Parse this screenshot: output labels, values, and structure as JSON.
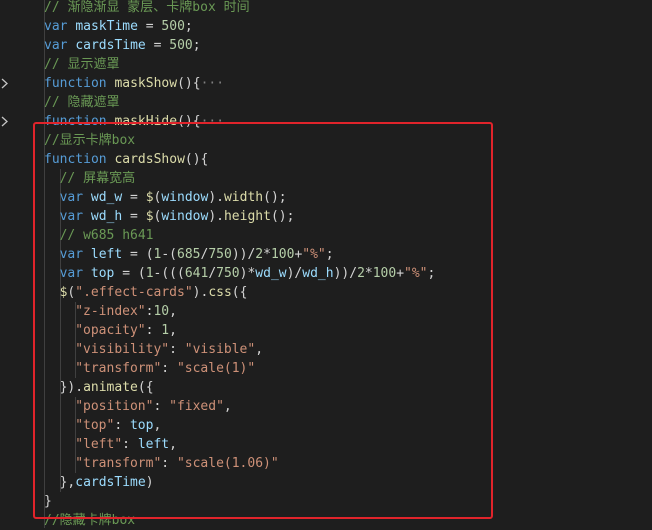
{
  "editor": {
    "lines": [
      {
        "tokens": [
          {
            "t": "// 渐隐渐显 蒙层、卡牌box 时间",
            "c": "c"
          }
        ]
      },
      {
        "tokens": [
          {
            "t": "var ",
            "c": "k"
          },
          {
            "t": "maskTime",
            "c": "v"
          },
          {
            "t": " = ",
            "c": "p"
          },
          {
            "t": "500",
            "c": "n"
          },
          {
            "t": ";",
            "c": "p"
          }
        ]
      },
      {
        "tokens": [
          {
            "t": "var ",
            "c": "k"
          },
          {
            "t": "cardsTime",
            "c": "v"
          },
          {
            "t": " = ",
            "c": "p"
          },
          {
            "t": "500",
            "c": "n"
          },
          {
            "t": ";",
            "c": "p"
          }
        ]
      },
      {
        "tokens": [
          {
            "t": "// 显示遮罩",
            "c": "c"
          }
        ]
      },
      {
        "fold": true,
        "tokens": [
          {
            "t": "function ",
            "c": "k"
          },
          {
            "t": "maskShow",
            "c": "f"
          },
          {
            "t": "(){",
            "c": "p"
          },
          {
            "t": "···",
            "c": "fold-dots"
          }
        ]
      },
      {
        "tokens": [
          {
            "t": "// 隐藏遮罩",
            "c": "c"
          }
        ]
      },
      {
        "fold": true,
        "tokens": [
          {
            "t": "function ",
            "c": "k"
          },
          {
            "t": "maskHide",
            "c": "f"
          },
          {
            "t": "(){",
            "c": "p"
          },
          {
            "t": "···",
            "c": "fold-dots"
          }
        ]
      },
      {
        "tokens": [
          {
            "t": "//显示卡牌box",
            "c": "c"
          }
        ]
      },
      {
        "tokens": [
          {
            "t": "function ",
            "c": "k"
          },
          {
            "t": "cardsShow",
            "c": "f"
          },
          {
            "t": "(){",
            "c": "p"
          }
        ]
      },
      {
        "indent": 1,
        "tokens": [
          {
            "t": "// 屏幕宽高",
            "c": "c"
          }
        ]
      },
      {
        "indent": 1,
        "tokens": [
          {
            "t": "var ",
            "c": "k"
          },
          {
            "t": "wd_w",
            "c": "v"
          },
          {
            "t": " = ",
            "c": "p"
          },
          {
            "t": "$",
            "c": "f"
          },
          {
            "t": "(",
            "c": "p"
          },
          {
            "t": "window",
            "c": "v"
          },
          {
            "t": ").",
            "c": "p"
          },
          {
            "t": "width",
            "c": "f"
          },
          {
            "t": "();",
            "c": "p"
          }
        ]
      },
      {
        "indent": 1,
        "tokens": [
          {
            "t": "var ",
            "c": "k"
          },
          {
            "t": "wd_h",
            "c": "v"
          },
          {
            "t": " = ",
            "c": "p"
          },
          {
            "t": "$",
            "c": "f"
          },
          {
            "t": "(",
            "c": "p"
          },
          {
            "t": "window",
            "c": "v"
          },
          {
            "t": ").",
            "c": "p"
          },
          {
            "t": "height",
            "c": "f"
          },
          {
            "t": "();",
            "c": "p"
          }
        ]
      },
      {
        "indent": 1,
        "tokens": [
          {
            "t": "// w685 h641",
            "c": "c"
          }
        ]
      },
      {
        "indent": 1,
        "tokens": [
          {
            "t": "var ",
            "c": "k"
          },
          {
            "t": "left",
            "c": "v"
          },
          {
            "t": " = (",
            "c": "p"
          },
          {
            "t": "1",
            "c": "n"
          },
          {
            "t": "-(",
            "c": "p"
          },
          {
            "t": "685",
            "c": "n"
          },
          {
            "t": "/",
            "c": "p"
          },
          {
            "t": "750",
            "c": "n"
          },
          {
            "t": "))/",
            "c": "p"
          },
          {
            "t": "2",
            "c": "n"
          },
          {
            "t": "*",
            "c": "p"
          },
          {
            "t": "100",
            "c": "n"
          },
          {
            "t": "+",
            "c": "p"
          },
          {
            "t": "\"%\"",
            "c": "s"
          },
          {
            "t": ";",
            "c": "p"
          }
        ]
      },
      {
        "indent": 1,
        "tokens": [
          {
            "t": "var ",
            "c": "k"
          },
          {
            "t": "top",
            "c": "v"
          },
          {
            "t": " = (",
            "c": "p"
          },
          {
            "t": "1",
            "c": "n"
          },
          {
            "t": "-(((",
            "c": "p"
          },
          {
            "t": "641",
            "c": "n"
          },
          {
            "t": "/",
            "c": "p"
          },
          {
            "t": "750",
            "c": "n"
          },
          {
            "t": ")*",
            "c": "p"
          },
          {
            "t": "wd_w",
            "c": "v"
          },
          {
            "t": ")/",
            "c": "p"
          },
          {
            "t": "wd_h",
            "c": "v"
          },
          {
            "t": "))/",
            "c": "p"
          },
          {
            "t": "2",
            "c": "n"
          },
          {
            "t": "*",
            "c": "p"
          },
          {
            "t": "100",
            "c": "n"
          },
          {
            "t": "+",
            "c": "p"
          },
          {
            "t": "\"%\"",
            "c": "s"
          },
          {
            "t": ";",
            "c": "p"
          }
        ]
      },
      {
        "indent": 1,
        "tokens": [
          {
            "t": "$",
            "c": "f"
          },
          {
            "t": "(",
            "c": "p"
          },
          {
            "t": "\".effect-cards\"",
            "c": "s"
          },
          {
            "t": ").",
            "c": "p"
          },
          {
            "t": "css",
            "c": "f"
          },
          {
            "t": "({",
            "c": "p"
          }
        ]
      },
      {
        "indent": 2,
        "tokens": [
          {
            "t": "\"z-index\"",
            "c": "s"
          },
          {
            "t": ":",
            "c": "p"
          },
          {
            "t": "10",
            "c": "n"
          },
          {
            "t": ",",
            "c": "p"
          }
        ]
      },
      {
        "indent": 2,
        "tokens": [
          {
            "t": "\"opacity\"",
            "c": "s"
          },
          {
            "t": ": ",
            "c": "p"
          },
          {
            "t": "1",
            "c": "n"
          },
          {
            "t": ",",
            "c": "p"
          }
        ]
      },
      {
        "indent": 2,
        "tokens": [
          {
            "t": "\"visibility\"",
            "c": "s"
          },
          {
            "t": ": ",
            "c": "p"
          },
          {
            "t": "\"visible\"",
            "c": "s"
          },
          {
            "t": ",",
            "c": "p"
          }
        ]
      },
      {
        "indent": 2,
        "tokens": [
          {
            "t": "\"transform\"",
            "c": "s"
          },
          {
            "t": ": ",
            "c": "p"
          },
          {
            "t": "\"scale(1)\"",
            "c": "s"
          }
        ]
      },
      {
        "indent": 1,
        "tokens": [
          {
            "t": "}).",
            "c": "p"
          },
          {
            "t": "animate",
            "c": "f"
          },
          {
            "t": "({",
            "c": "p"
          }
        ]
      },
      {
        "indent": 2,
        "tokens": [
          {
            "t": "\"position\"",
            "c": "s"
          },
          {
            "t": ": ",
            "c": "p"
          },
          {
            "t": "\"fixed\"",
            "c": "s"
          },
          {
            "t": ",",
            "c": "p"
          }
        ]
      },
      {
        "indent": 2,
        "tokens": [
          {
            "t": "\"top\"",
            "c": "s"
          },
          {
            "t": ": ",
            "c": "p"
          },
          {
            "t": "top",
            "c": "v"
          },
          {
            "t": ",",
            "c": "p"
          }
        ]
      },
      {
        "indent": 2,
        "tokens": [
          {
            "t": "\"left\"",
            "c": "s"
          },
          {
            "t": ": ",
            "c": "p"
          },
          {
            "t": "left",
            "c": "v"
          },
          {
            "t": ",",
            "c": "p"
          }
        ]
      },
      {
        "indent": 2,
        "tokens": [
          {
            "t": "\"transform\"",
            "c": "s"
          },
          {
            "t": ": ",
            "c": "p"
          },
          {
            "t": "\"scale(1.06)\"",
            "c": "s"
          }
        ]
      },
      {
        "indent": 1,
        "tokens": [
          {
            "t": "},",
            "c": "p"
          },
          {
            "t": "cardsTime",
            "c": "v"
          },
          {
            "t": ")",
            "c": "p"
          }
        ]
      },
      {
        "tokens": [
          {
            "t": "}",
            "c": "p"
          }
        ]
      },
      {
        "tokens": [
          {
            "t": "//隐藏卡牌box",
            "c": "c"
          }
        ]
      }
    ]
  },
  "colors": {
    "background": "#1e1e1e",
    "highlight_border": "#e0242b"
  },
  "icons": {
    "fold": "chevron-right-icon"
  }
}
